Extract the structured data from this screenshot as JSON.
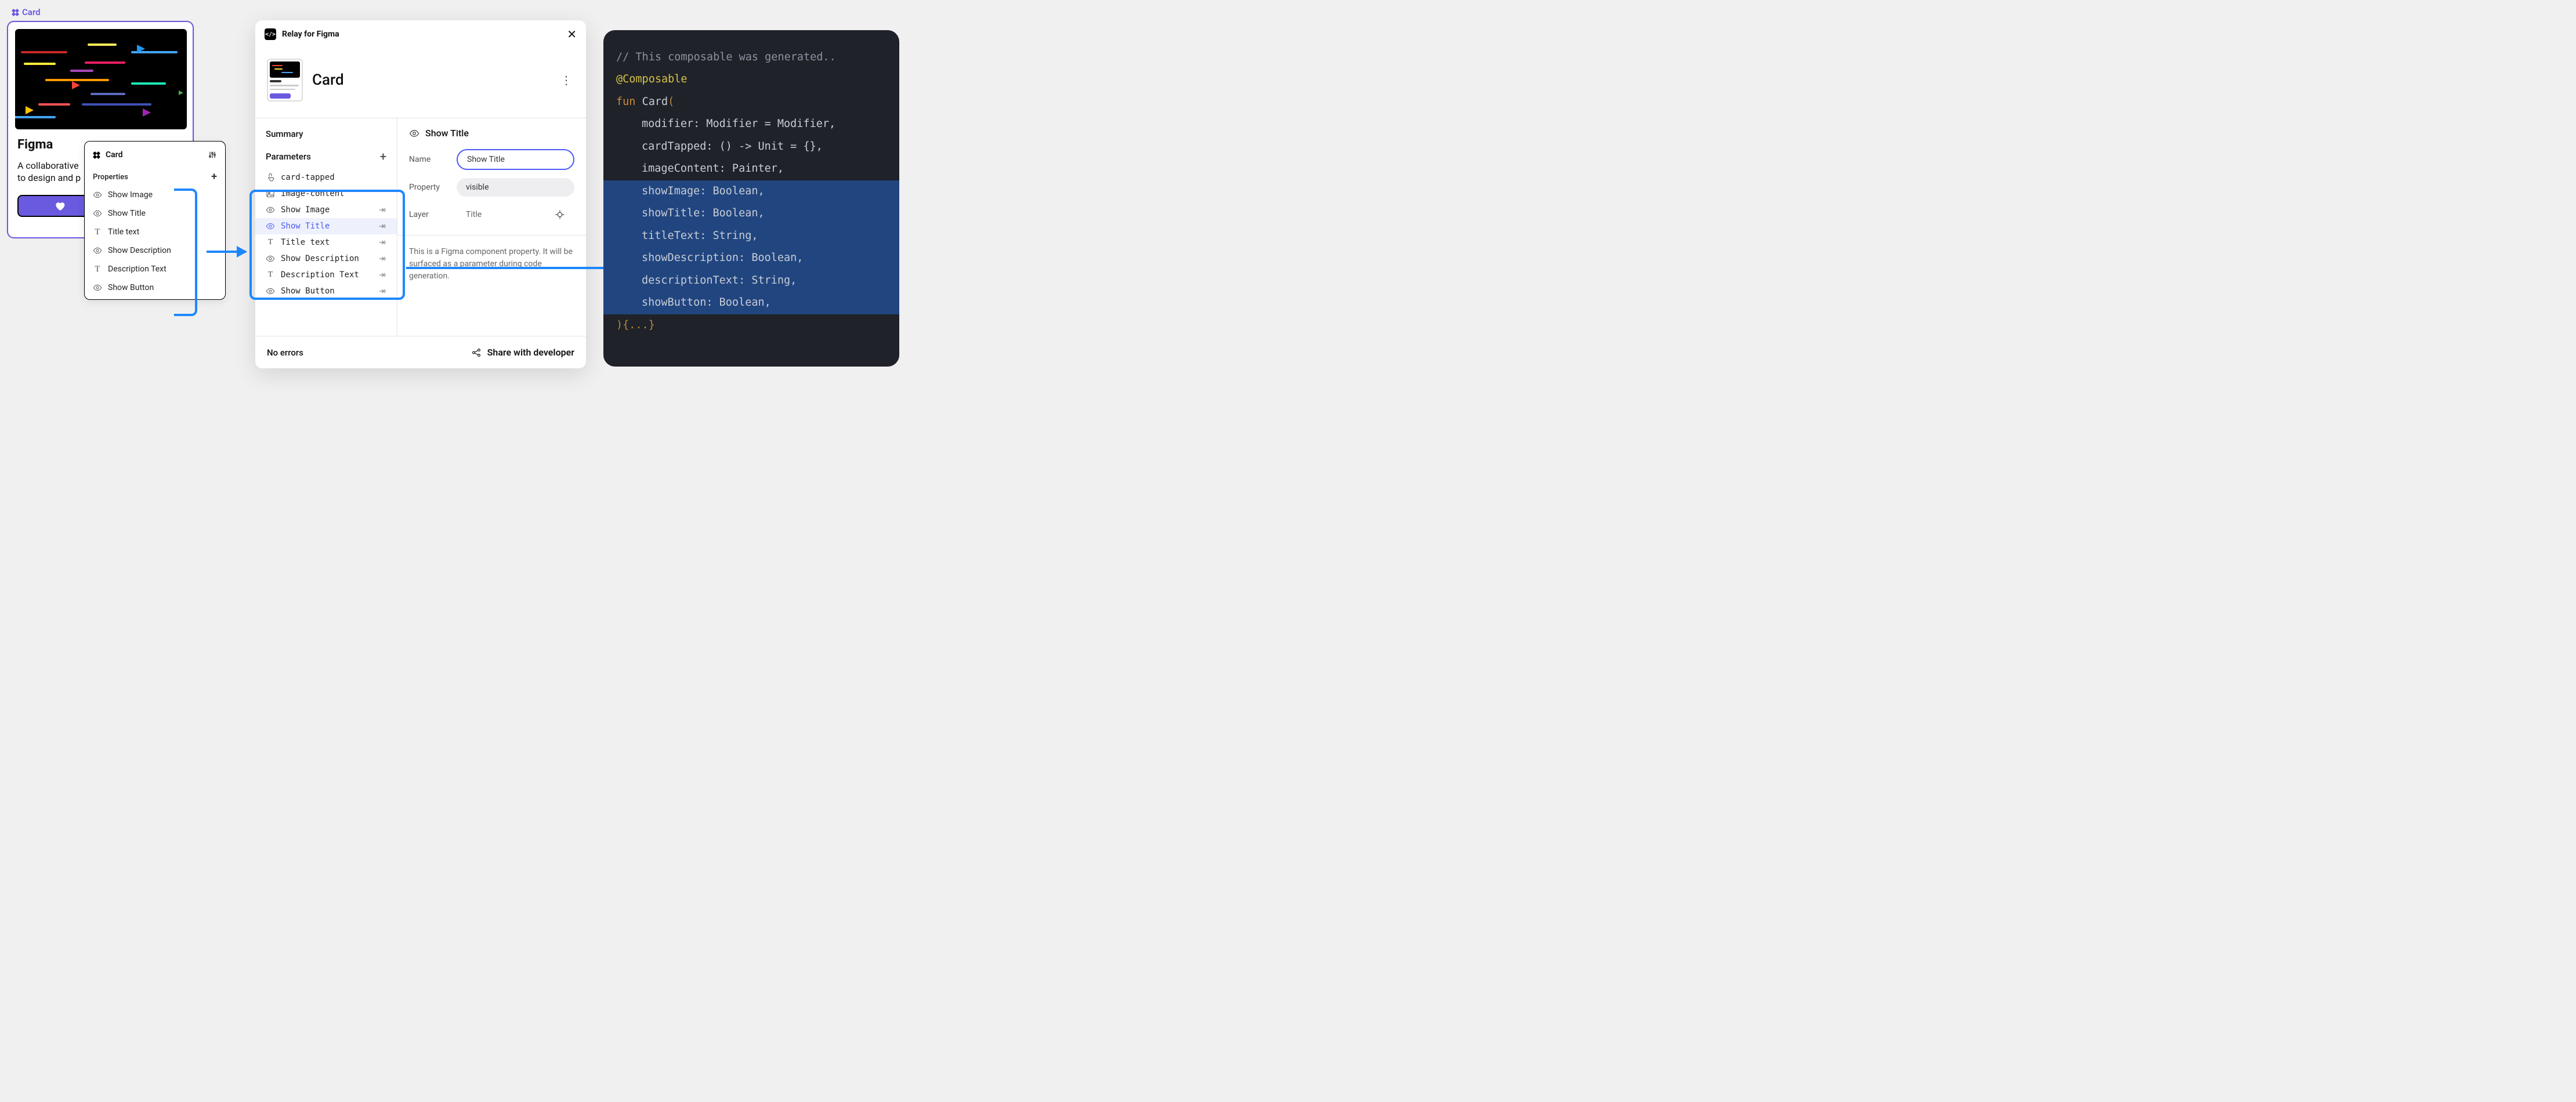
{
  "figma": {
    "component_label": "Card",
    "card": {
      "title": "Figma",
      "description_line1": "A collaborative",
      "description_line2": "to design and p"
    },
    "properties_popover": {
      "header": "Card",
      "section": "Properties",
      "items": [
        {
          "icon": "eye",
          "label": "Show Image"
        },
        {
          "icon": "eye",
          "label": "Show Title"
        },
        {
          "icon": "text",
          "label": "Title text"
        },
        {
          "icon": "eye",
          "label": "Show Description"
        },
        {
          "icon": "text",
          "label": "Description Text"
        },
        {
          "icon": "eye",
          "label": "Show Button"
        }
      ]
    }
  },
  "relay": {
    "title": "Relay for Figma",
    "heading": "Card",
    "summary_label": "Summary",
    "params_label": "Parameters",
    "params": [
      {
        "icon": "tap",
        "label": "card-tapped",
        "hasArrow": false
      },
      {
        "icon": "image",
        "label": "image-content",
        "hasArrow": false
      },
      {
        "icon": "eye",
        "label": "Show Image",
        "hasArrow": true
      },
      {
        "icon": "eye",
        "label": "Show Title",
        "hasArrow": true,
        "selected": true
      },
      {
        "icon": "text",
        "label": "Title text",
        "hasArrow": true
      },
      {
        "icon": "eye",
        "label": "Show Description",
        "hasArrow": true
      },
      {
        "icon": "text",
        "label": "Description Text",
        "hasArrow": true
      },
      {
        "icon": "eye",
        "label": "Show Button",
        "hasArrow": true
      }
    ],
    "detail": {
      "title": "Show Title",
      "name_label": "Name",
      "name_value": "Show Title",
      "property_label": "Property",
      "property_value": "visible",
      "layer_label": "Layer",
      "layer_value": "Title",
      "description": "This is a Figma component property. It will be surfaced as a parameter during code generation."
    },
    "footer": {
      "no_errors": "No errors",
      "share": "Share with developer"
    }
  },
  "code": {
    "comment": "// This composable was generated..",
    "annotation": "@Composable",
    "keyword_fun": "fun",
    "fn_name": "Card",
    "paren_open": "(",
    "lines": [
      "modifier: Modifier = Modifier,",
      "cardTapped: () -> Unit = {},",
      "imageContent: Painter,"
    ],
    "hl_lines": [
      "showImage: Boolean,",
      "showTitle: Boolean,",
      "titleText: String,",
      "showDescription: Boolean,",
      "descriptionText: String,",
      "showButton: Boolean,"
    ],
    "close": "){...}"
  }
}
